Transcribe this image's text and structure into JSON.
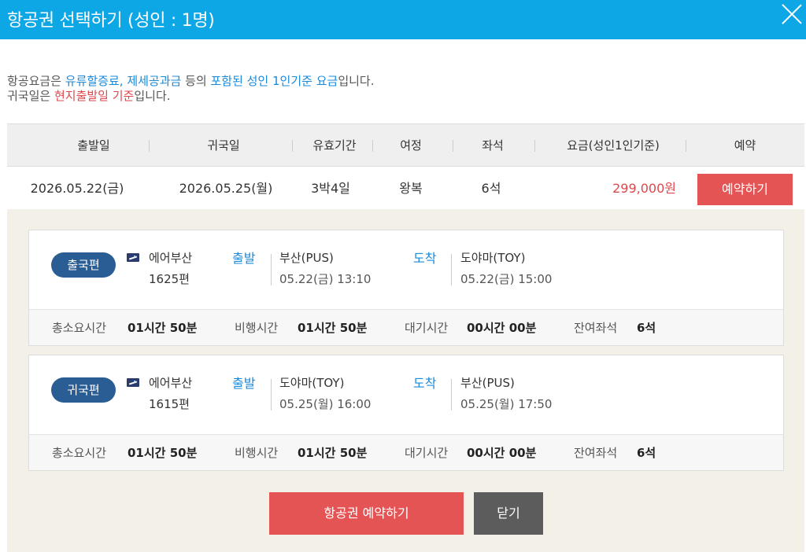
{
  "header": {
    "title": "항공권 선택하기 (성인 : 1명)"
  },
  "notice": {
    "line1_prefix": "항공요금은 ",
    "line1_blue1": "유류할증료, 제세공과금",
    "line1_mid": " 등의 ",
    "line1_blue2": "포함된 성인 1인기준 요금",
    "line1_suffix": "입니다.",
    "line2_prefix": "귀국일은 ",
    "line2_red": "현지출발일 기준",
    "line2_suffix": "입니다."
  },
  "fare_table": {
    "columns": [
      "출발일",
      "귀국일",
      "유효기간",
      "여정",
      "좌석",
      "요금(성인1인기준)",
      "예약"
    ],
    "row": {
      "departure_date": "2026.05.22(금)",
      "return_date": "2026.05.25(월)",
      "validity": "3박4일",
      "itinerary": "왕복",
      "seats": "6석",
      "price": "299,000원",
      "reserve_label": "예약하기"
    }
  },
  "flights": [
    {
      "badge": "출국편",
      "airline": "에어부산",
      "flight_no": "1625편",
      "depart_label": "출발",
      "depart_city": "부산(PUS)",
      "depart_time": "05.22(금) 13:10",
      "arrive_label": "도착",
      "arrive_city": "도야마(TOY)",
      "arrive_time": "05.22(금) 15:00",
      "total_label": "총소요시간",
      "total_value": "01시간 50분",
      "flight_label": "비행시간",
      "flight_value": "01시간 50분",
      "wait_label": "대기시간",
      "wait_value": "00시간 00분",
      "seats_label": "잔여좌석",
      "seats_value": "6석"
    },
    {
      "badge": "귀국편",
      "airline": "에어부산",
      "flight_no": "1615편",
      "depart_label": "출발",
      "depart_city": "도야마(TOY)",
      "depart_time": "05.25(월) 16:00",
      "arrive_label": "도착",
      "arrive_city": "부산(PUS)",
      "arrive_time": "05.25(월) 17:50",
      "total_label": "총소요시간",
      "total_value": "01시간 50분",
      "flight_label": "비행시간",
      "flight_value": "01시간 50분",
      "wait_label": "대기시간",
      "wait_value": "00시간 00분",
      "seats_label": "잔여좌석",
      "seats_value": "6석"
    }
  ],
  "actions": {
    "book_label": "항공권 예약하기",
    "close_label": "닫기"
  },
  "colors": {
    "header_bg": "#0ea7e6",
    "accent_blue": "#1a8ad9",
    "accent_red": "#e45455",
    "badge_bg": "#2a5d93",
    "panel_bg": "#f3f0e8"
  },
  "icons": {
    "close": "close-icon",
    "airline": "airline-logo-icon"
  }
}
